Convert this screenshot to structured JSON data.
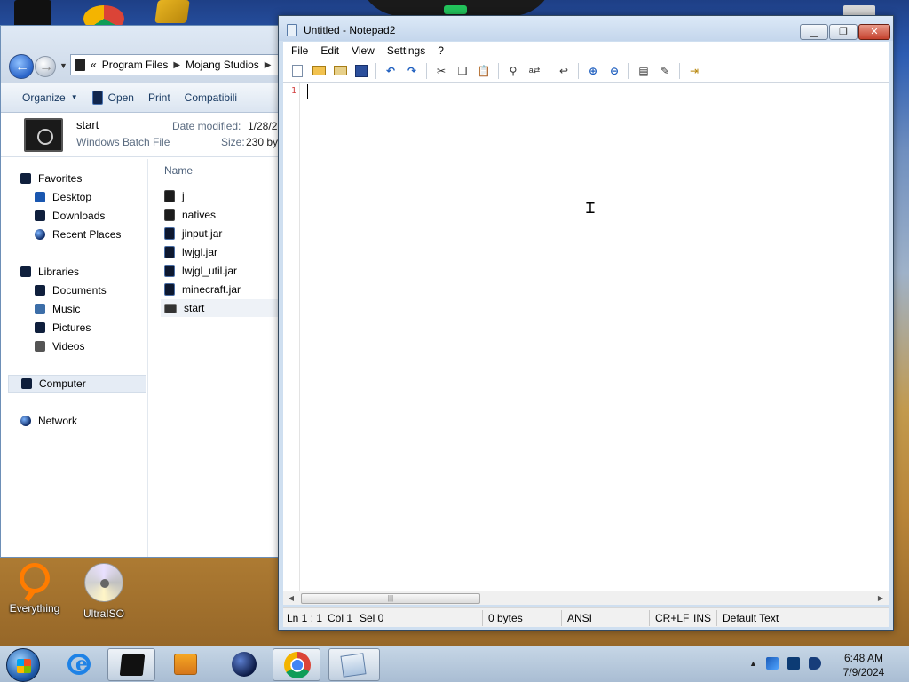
{
  "explorer": {
    "breadcrumb": [
      "Program Files",
      "Mojang Studios"
    ],
    "breadcrumb_prefix": "«",
    "toolbar": {
      "organize": "Organize",
      "open": "Open",
      "print": "Print",
      "compat": "Compatibili"
    },
    "preview": {
      "name": "start",
      "type": "Windows Batch File",
      "date_label": "Date modified:",
      "date_value": "1/28/2",
      "size_label": "Size:",
      "size_value": "230 by"
    },
    "sidebar": {
      "favorites": "Favorites",
      "desktop": "Desktop",
      "downloads": "Downloads",
      "recent": "Recent Places",
      "libraries": "Libraries",
      "documents": "Documents",
      "music": "Music",
      "pictures": "Pictures",
      "videos": "Videos",
      "computer": "Computer",
      "network": "Network"
    },
    "column_name": "Name",
    "files": [
      "j",
      "natives",
      "jinput.jar",
      "lwjgl.jar",
      "lwjgl_util.jar",
      "minecraft.jar",
      "start"
    ]
  },
  "desktop_icons": {
    "everything": "Everything",
    "ultraiso": "UltraISO"
  },
  "notepad": {
    "title": "Untitled - Notepad2",
    "menu": [
      "File",
      "Edit",
      "View",
      "Settings",
      "?"
    ],
    "line_number": "1",
    "status": {
      "ln": "Ln 1 : 1",
      "col": "Col 1",
      "sel": "Sel 0",
      "bytes": "0 bytes",
      "encoding": "ANSI",
      "eol": "CR+LF",
      "mode": "INS",
      "scheme": "Default Text"
    }
  },
  "taskbar": {
    "time": "6:48 AM",
    "date": "7/9/2024"
  },
  "colors": {
    "accent": "#1f5fbf",
    "line_number": "#d24040",
    "title_bar": "#c4d6ec"
  }
}
